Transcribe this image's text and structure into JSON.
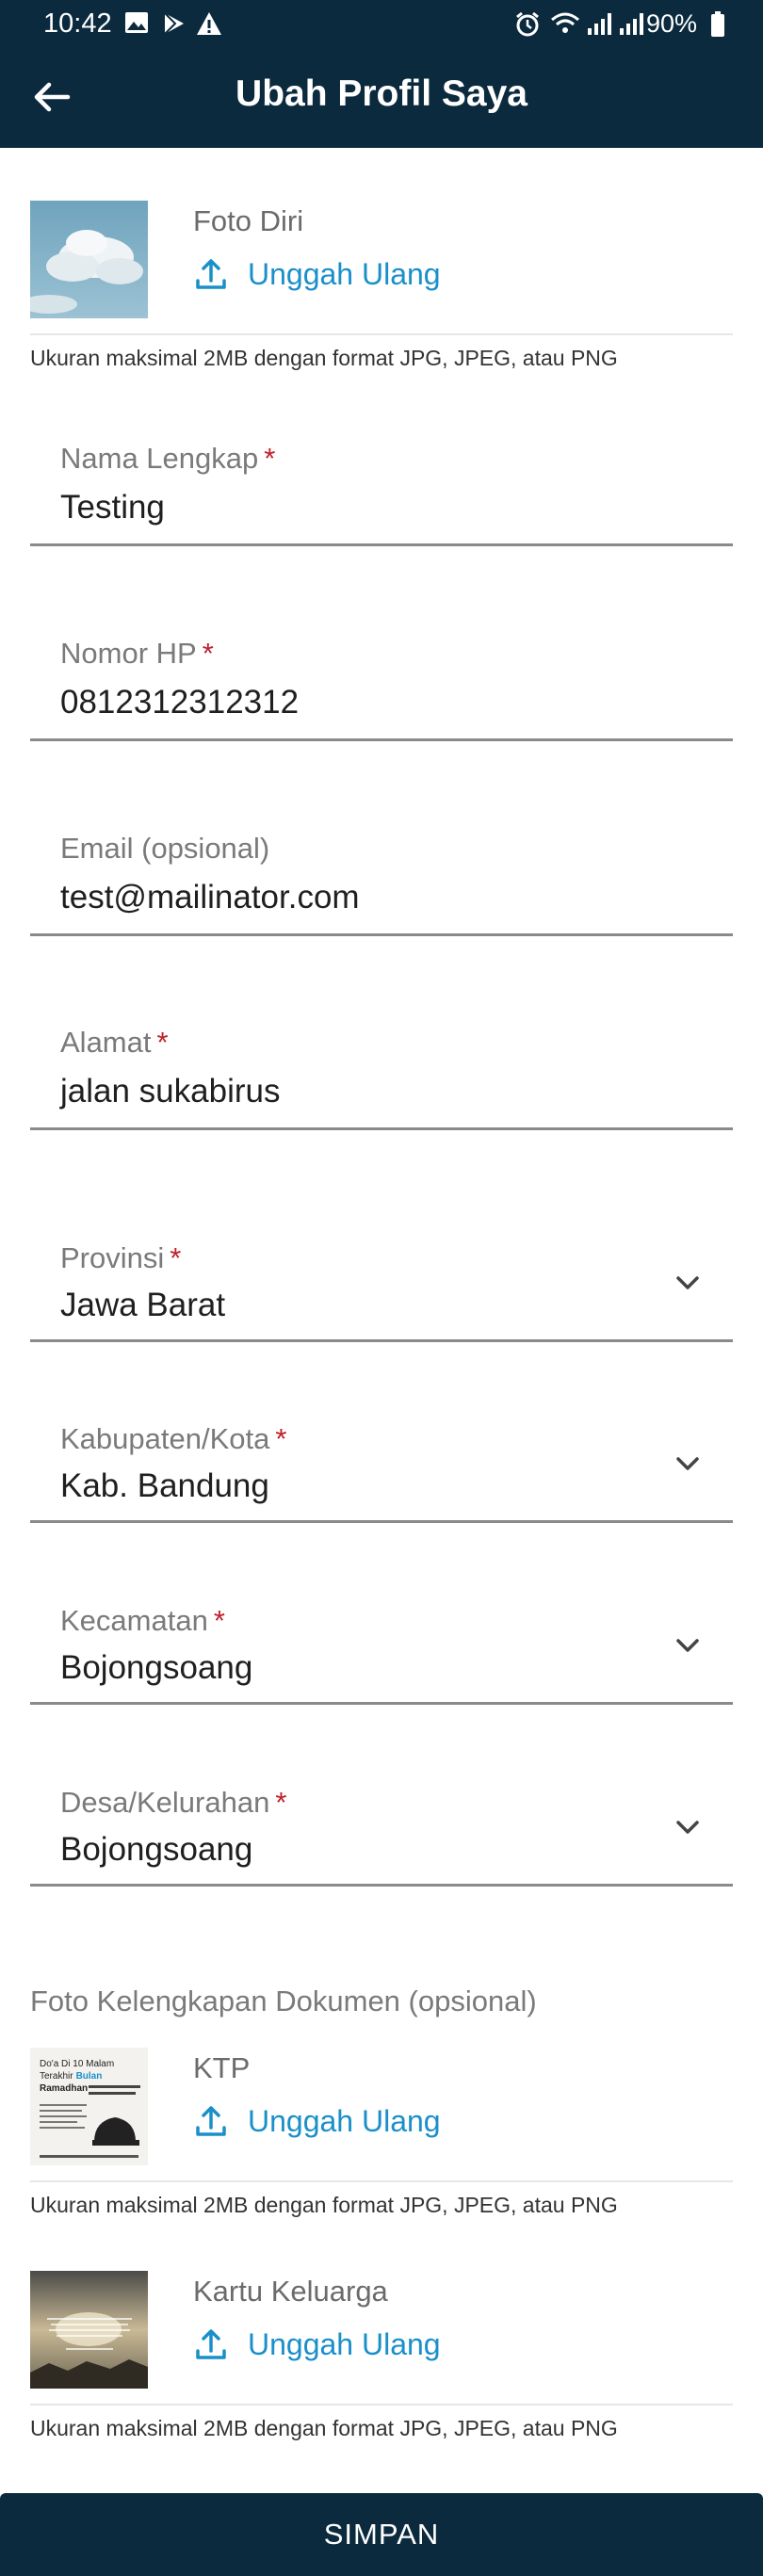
{
  "status_bar": {
    "time": "10:42",
    "battery": "90%"
  },
  "app_bar": {
    "title": "Ubah Profil Saya"
  },
  "profile_photo": {
    "label": "Foto Diri",
    "upload_label": "Unggah Ulang",
    "hint": "Ukuran maksimal 2MB dengan format JPG, JPEG, atau PNG"
  },
  "fields": {
    "nama": {
      "label": "Nama Lengkap",
      "required_mark": "*",
      "value": "Testing"
    },
    "hp": {
      "label": "Nomor HP",
      "required_mark": "*",
      "value": "0812312312312"
    },
    "email": {
      "label": "Email (opsional)",
      "value": "test@mailinator.com"
    },
    "alamat": {
      "label": "Alamat",
      "required_mark": "*",
      "value": "jalan sukabirus"
    },
    "provinsi": {
      "label": "Provinsi",
      "required_mark": "*",
      "value": "Jawa Barat"
    },
    "kabupaten": {
      "label": "Kabupaten/Kota",
      "required_mark": "*",
      "value": "Kab. Bandung"
    },
    "kecamatan": {
      "label": "Kecamatan",
      "required_mark": "*",
      "value": "Bojongsoang"
    },
    "desa": {
      "label": "Desa/Kelurahan",
      "required_mark": "*",
      "value": "Bojongsoang"
    }
  },
  "documents": {
    "section_title": "Foto Kelengkapan Dokumen (opsional)",
    "ktp": {
      "label": "KTP",
      "upload_label": "Unggah Ulang",
      "hint": "Ukuran maksimal 2MB dengan format JPG, JPEG, atau PNG",
      "thumb_text": {
        "line1": "Do'a Di 10 Malam",
        "line2": "Terakhir",
        "line2b": "Bulan",
        "line3": "Ramadhan"
      }
    },
    "kk": {
      "label": "Kartu Keluarga",
      "upload_label": "Unggah Ulang",
      "hint": "Ukuran maksimal 2MB dengan format JPG, JPEG, atau PNG"
    }
  },
  "save_button": {
    "label": "SIMPAN"
  },
  "colors": {
    "primary": "#0b2a3e",
    "accent": "#1a8fc9",
    "required": "#c0202c"
  }
}
